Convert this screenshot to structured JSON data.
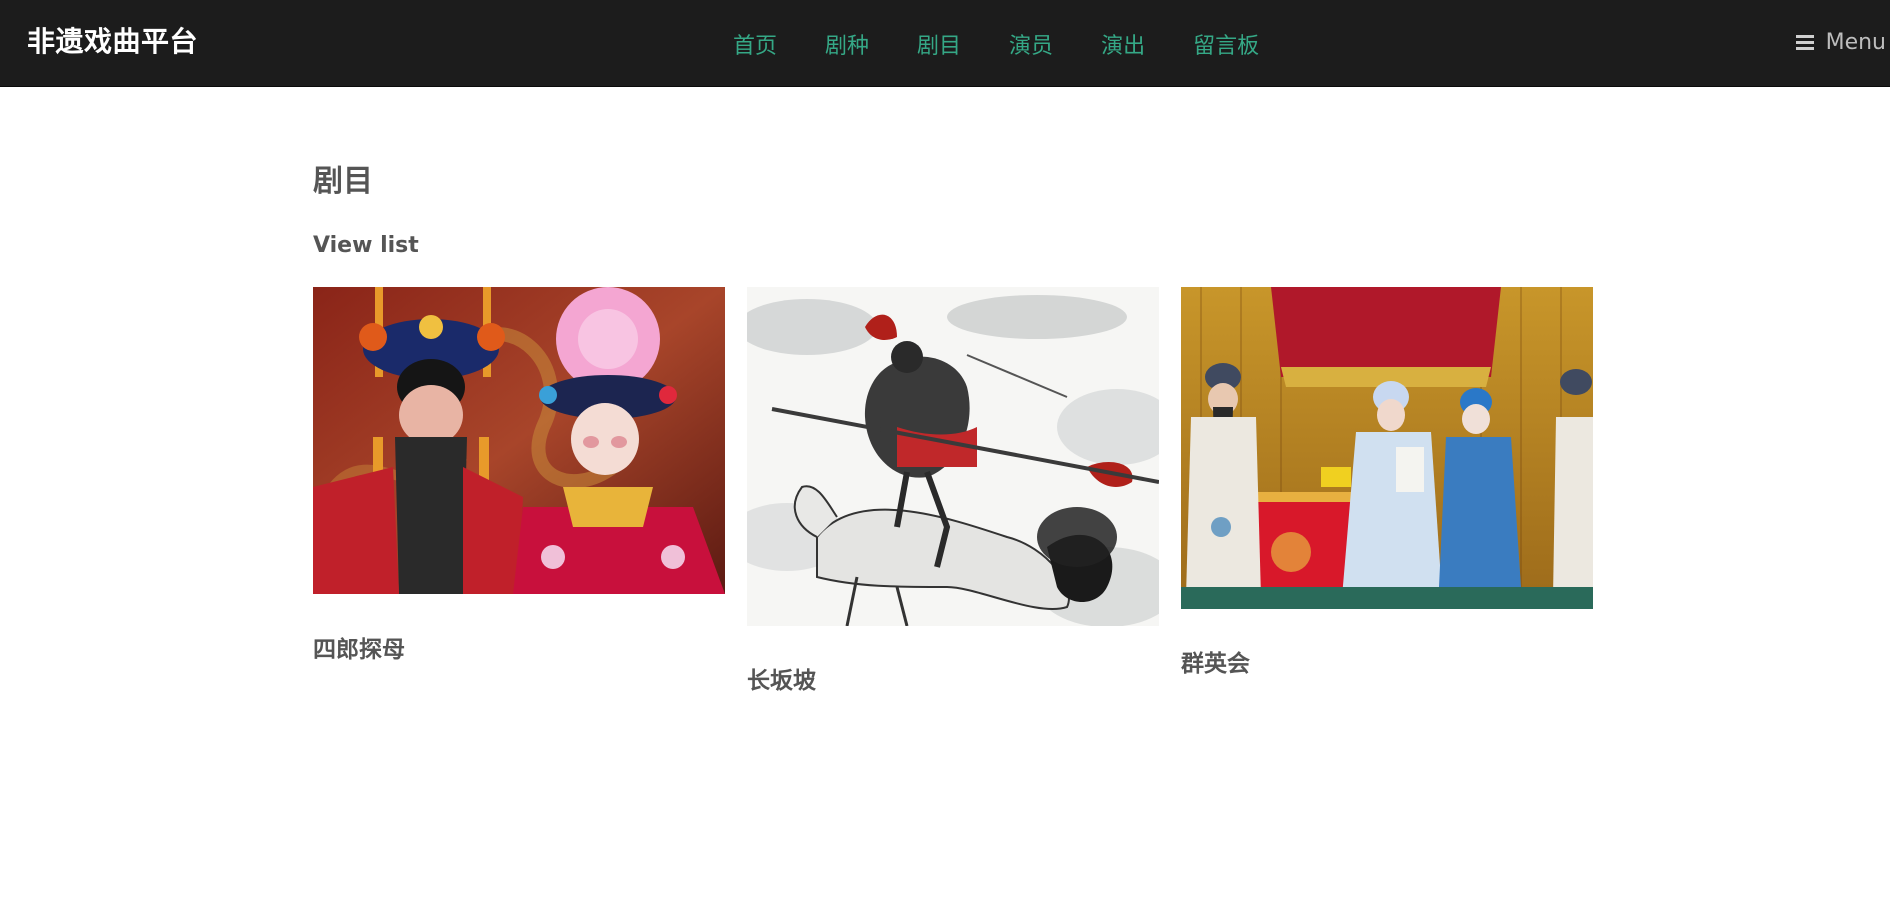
{
  "header": {
    "brand": "非遗戏曲平台",
    "nav": [
      {
        "label": "首页"
      },
      {
        "label": "剧种"
      },
      {
        "label": "剧目"
      },
      {
        "label": "演员"
      },
      {
        "label": "演出"
      },
      {
        "label": "留言板"
      }
    ],
    "menu_label": "Menu",
    "menu_icon": "hamburger-icon"
  },
  "main": {
    "title": "剧目",
    "view_list": "View list",
    "cards": [
      {
        "title": "四郎探母",
        "image": "peking-opera-couple-photo"
      },
      {
        "title": "长坂坡",
        "image": "ink-painting-warrior-on-horse"
      },
      {
        "title": "群英会",
        "image": "peking-opera-stage-performance-photo"
      }
    ]
  },
  "colors": {
    "navbar_bg": "#1c1c1c",
    "nav_link": "#35a886",
    "brand": "#ffffff",
    "menu_text": "#bdbdbd",
    "heading": "#555555",
    "page_bg": "#ffffff"
  }
}
